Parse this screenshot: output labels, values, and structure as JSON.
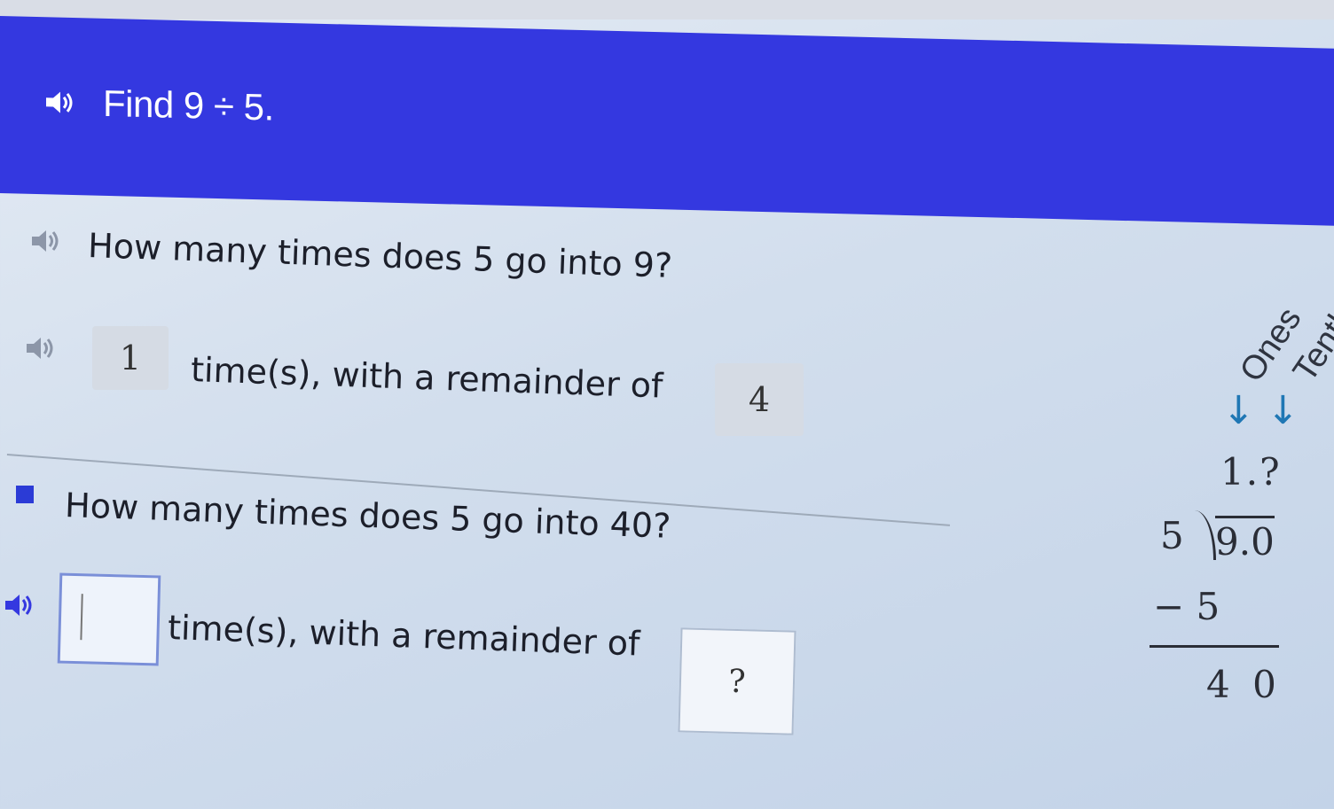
{
  "header": {
    "prompt_text": "Find 9 ÷ 5."
  },
  "step1": {
    "question": "How many times does 5 go into 9?",
    "quotient": "1",
    "text": "time(s), with a remainder of",
    "remainder": "4"
  },
  "step2": {
    "question": "How many times does 5 go into 40?",
    "quotient_value": "",
    "text": "time(s), with a remainder of",
    "remainder": "?"
  },
  "long_division": {
    "ones_label": "Ones",
    "tenths_label": "Tenth",
    "quotient": "1.?",
    "divisor": "5",
    "dividend": "9.0",
    "subtract": "− 5",
    "remainder": "4 0"
  },
  "colors": {
    "banner": "#3438e0",
    "arrow": "#1f77b4",
    "input_border": "#7a8fd8"
  }
}
